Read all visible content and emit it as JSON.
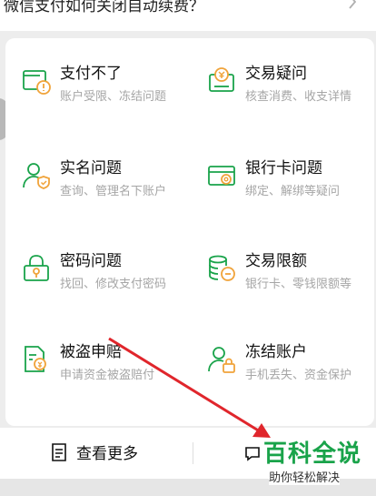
{
  "top_item": {
    "question": "微信支付如何关闭自动续费？"
  },
  "grid": [
    {
      "title": "支付不了",
      "sub": "账户受限、冻结问题",
      "icon": "wallet-alert-icon"
    },
    {
      "title": "交易疑问",
      "sub": "核查消费、收支详情",
      "icon": "yuan-receipt-icon"
    },
    {
      "title": "实名问题",
      "sub": "查询、管理名下账户",
      "icon": "user-verify-icon"
    },
    {
      "title": "银行卡问题",
      "sub": "绑定、解绑等疑问",
      "icon": "bank-card-icon"
    },
    {
      "title": "密码问题",
      "sub": "找回、修改支付密码",
      "icon": "password-lock-icon"
    },
    {
      "title": "交易限额",
      "sub": "银行卡、零钱限额等",
      "icon": "coin-stack-icon"
    },
    {
      "title": "被盗申赔",
      "sub": "申请资金被盗赔付",
      "icon": "claim-document-icon"
    },
    {
      "title": "冻结账户",
      "sub": "手机丢失、资金保护",
      "icon": "user-lock-icon"
    }
  ],
  "bottom_bar": {
    "more_label": "查看更多"
  },
  "watermark": {
    "brand": "百科全说",
    "tagline": "助你轻松解决"
  },
  "colors": {
    "accent": "#19a34a",
    "arrow": "#e0262c"
  }
}
